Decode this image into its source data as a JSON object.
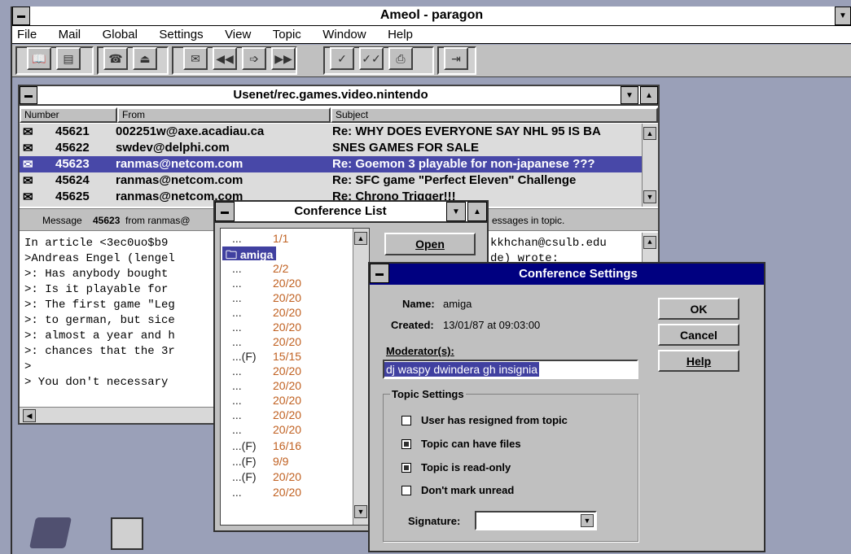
{
  "app": {
    "title": "Ameol - paragon",
    "menu": [
      "File",
      "Mail",
      "Global",
      "Settings",
      "View",
      "Topic",
      "Window",
      "Help"
    ],
    "toolbar_icons": [
      "open-book-icon",
      "folders-icon",
      "phone-icon",
      "phone-dial-icon",
      "mailbox-icon",
      "rewind-icon",
      "forward-mail-icon",
      "fast-forward-icon",
      "check-icon",
      "check-all-icon",
      "printer-icon",
      "exit-door-icon"
    ]
  },
  "message_window": {
    "title": "Usenet/rec.games.video.nintendo",
    "columns": [
      "Number",
      "From",
      "Subject"
    ],
    "rows": [
      {
        "number": "45621",
        "from": "002251w@axe.acadiau.ca",
        "subject": "Re: WHY DOES EVERYONE SAY NHL 95 IS BA"
      },
      {
        "number": "45622",
        "from": "swdev@delphi.com",
        "subject": "SNES GAMES FOR SALE"
      },
      {
        "number": "45623",
        "from": "ranmas@netcom.com",
        "subject": "Re: Goemon 3 playable for non-japanese ???"
      },
      {
        "number": "45624",
        "from": "ranmas@netcom.com",
        "subject": "Re: SFC game \"Perfect Eleven\" Challenge"
      },
      {
        "number": "45625",
        "from": "ranmas@netcom.com",
        "subject": "Re: Chrono Trigger!!!"
      }
    ],
    "status_left_prefix": "Message",
    "status_left_number": "45623",
    "status_left_from": "from ranmas@",
    "status_right": "essages in topic.",
    "body_lines": [
      "In article <3ec0uo$b9",
      ">Andreas Engel (lengel",
      ">: Has anybody bought",
      ">: Is it playable for",
      ">: The first game \"Leg",
      ">: to german, but sice",
      ">: almost a year and h",
      ">: chances that the 3r",
      ">",
      ">   You don't necessary"
    ],
    "body_right_1": "kkhchan@csulb.edu",
    "body_right_2": "de) wrote:"
  },
  "conference_list": {
    "title": "Conference List",
    "open_label": "Open",
    "items": [
      {
        "dots": "...",
        "count": "1/1"
      },
      {
        "dots": "amiga",
        "count": "",
        "folder": true
      },
      {
        "dots": "...",
        "count": "2/2"
      },
      {
        "dots": "...",
        "count": "20/20"
      },
      {
        "dots": "...",
        "count": "20/20"
      },
      {
        "dots": "...",
        "count": "20/20"
      },
      {
        "dots": "...",
        "count": "20/20"
      },
      {
        "dots": "...",
        "count": "20/20"
      },
      {
        "dots": "...(F)",
        "count": "15/15"
      },
      {
        "dots": "...",
        "count": "20/20"
      },
      {
        "dots": "...",
        "count": "20/20"
      },
      {
        "dots": "...",
        "count": "20/20"
      },
      {
        "dots": "...",
        "count": "20/20"
      },
      {
        "dots": "...",
        "count": "20/20"
      },
      {
        "dots": "...(F)",
        "count": "16/16"
      },
      {
        "dots": "...(F)",
        "count": "9/9"
      },
      {
        "dots": "...(F)",
        "count": "20/20"
      },
      {
        "dots": "...",
        "count": "20/20"
      }
    ]
  },
  "settings": {
    "title": "Conference Settings",
    "name_label": "Name:",
    "name_value": "amiga",
    "created_label": "Created:",
    "created_value": "13/01/87 at 09:03:00",
    "moderators_label": "Moderator(s):",
    "moderators_value": "dj waspy dwindera gh insignia",
    "ok": "OK",
    "cancel": "Cancel",
    "help": "Help",
    "group_label": "Topic Settings",
    "opt1": "User has resigned from topic",
    "opt2": "Topic can have files",
    "opt3": "Topic is read-only",
    "opt4": "Don't mark unread",
    "signature_label": "Signature:",
    "signature_value": "",
    "opt1_checked": false,
    "opt2_checked": true,
    "opt3_checked": true,
    "opt4_checked": false
  }
}
